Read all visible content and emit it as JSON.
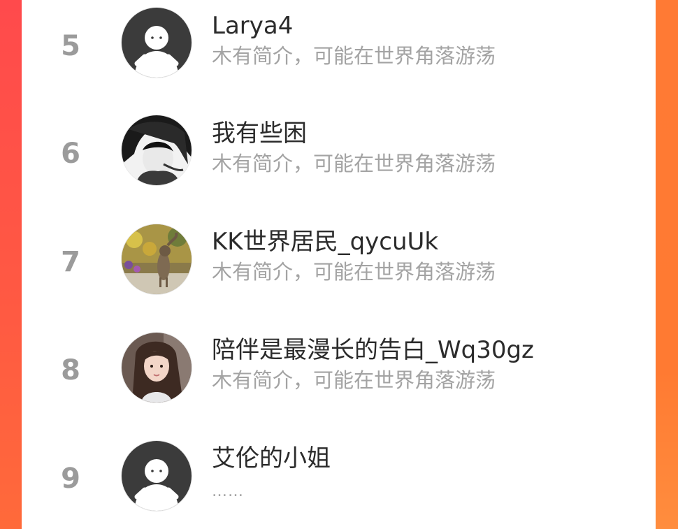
{
  "users": [
    {
      "rank": "5",
      "name": "Larya4",
      "bio": "木有简介，可能在世界角落游荡",
      "avatar": "default-avatar-icon"
    },
    {
      "rank": "6",
      "name": "我有些困",
      "bio": "木有简介，可能在世界角落游荡",
      "avatar": "user-photo-avatar"
    },
    {
      "rank": "7",
      "name": "KK世界居民_qycuUk",
      "bio": "木有简介，可能在世界角落游荡",
      "avatar": "user-photo-avatar"
    },
    {
      "rank": "8",
      "name": "陪伴是最漫长的告白_Wq30gz",
      "bio": "木有简介，可能在世界角落游荡",
      "avatar": "user-photo-avatar"
    },
    {
      "rank": "9",
      "name": "艾伦的小姐",
      "bio": "……",
      "avatar": "default-avatar-icon"
    }
  ],
  "colors": {
    "background_accent": "#ff5a44",
    "card": "#ffffff",
    "rank": "#9b9b9b",
    "name": "#2b2b2b",
    "bio": "#a3a3a3"
  }
}
